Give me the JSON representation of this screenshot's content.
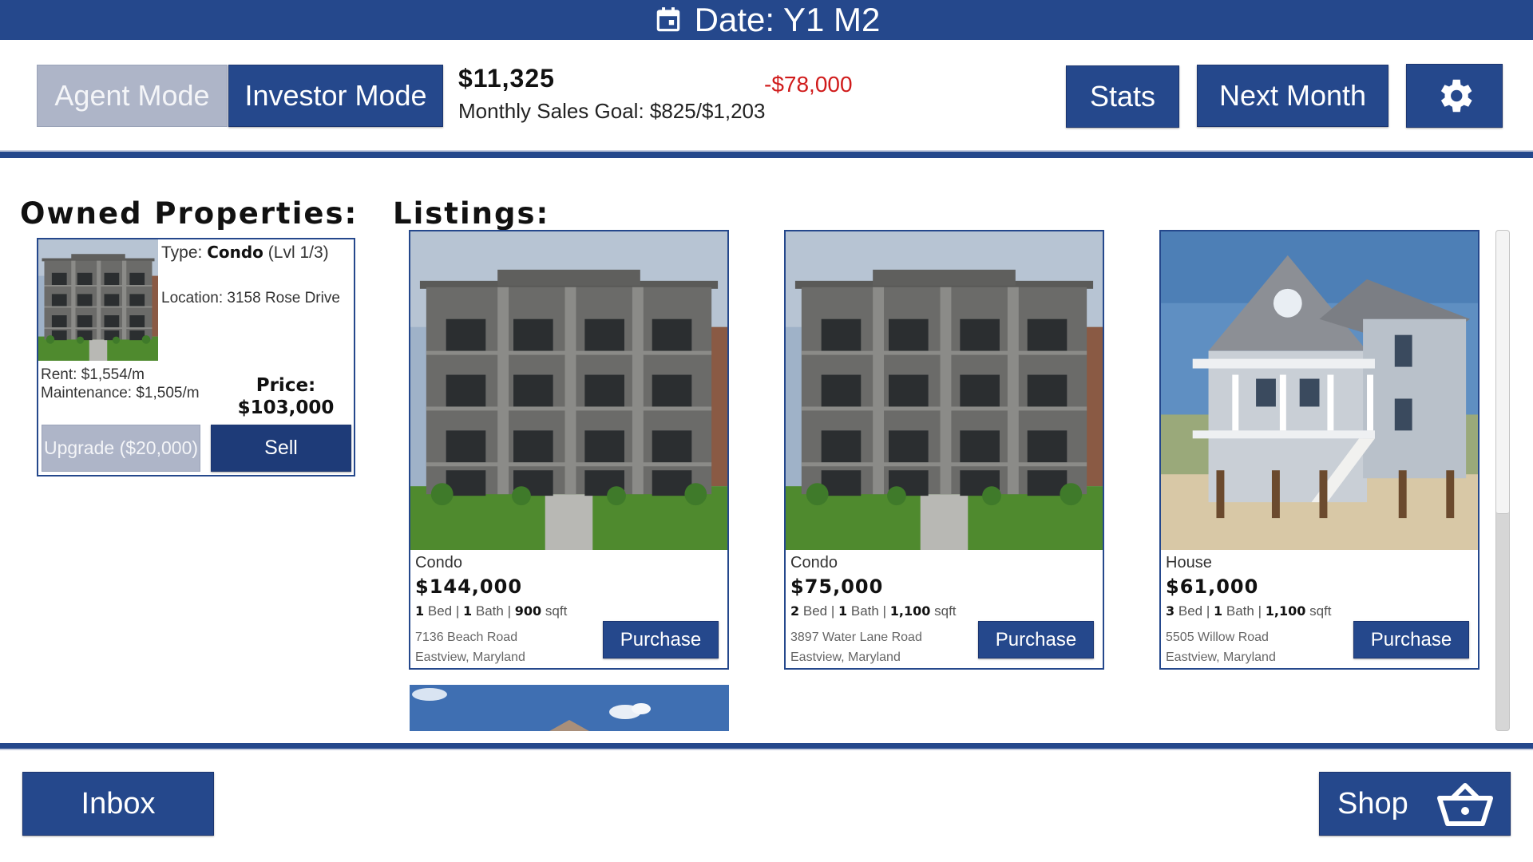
{
  "topbar": {
    "date_label": "Date: Y1 M2",
    "calendar_icon": "calendar-icon"
  },
  "header": {
    "agent_mode": "Agent Mode",
    "investor_mode": "Investor Mode",
    "balance": "$11,325",
    "sales_goal": "Monthly Sales Goal: $825/$1,203",
    "balance_change": "-$78,000",
    "stats_label": "Stats",
    "next_month_label": "Next Month",
    "settings_icon": "gear-icon"
  },
  "owned": {
    "heading": "Owned Properties:",
    "items": [
      {
        "type_prefix": "Type: ",
        "type": "Condo",
        "level": "(Lvl 1/3)",
        "location": "Location: 3158 Rose Drive",
        "rent": "Rent: $1,554/m",
        "maintenance": "Maintenance: $1,505/m",
        "price_label": "Price:",
        "price": "$103,000",
        "upgrade_label": "Upgrade ($20,000)",
        "sell_label": "Sell"
      }
    ]
  },
  "listings": {
    "heading": "Listings:",
    "items": [
      {
        "type": "Condo",
        "price": "$144,000",
        "beds": "1",
        "baths": "1",
        "sqft": "900",
        "street": "7136 Beach Road",
        "city": "Eastview, Maryland",
        "purchase_label": "Purchase"
      },
      {
        "type": "Condo",
        "price": "$75,000",
        "beds": "2",
        "baths": "1",
        "sqft": "1,100",
        "street": "3897 Water Lane Road",
        "city": "Eastview, Maryland",
        "purchase_label": "Purchase"
      },
      {
        "type": "House",
        "price": "$61,000",
        "beds": "3",
        "baths": "1",
        "sqft": "1,100",
        "street": "5505 Willow Road",
        "city": "Eastview, Maryland",
        "purchase_label": "Purchase"
      }
    ],
    "spec_words": {
      "bed": "Bed",
      "bath": "Bath",
      "sqft": "sqft",
      "sep": "|"
    }
  },
  "footer": {
    "inbox_label": "Inbox",
    "shop_label": "Shop",
    "shop_icon": "basket-icon"
  },
  "colors": {
    "primary": "#25488c",
    "disabled": "#aeb5c8",
    "negative": "#d01b1b"
  }
}
